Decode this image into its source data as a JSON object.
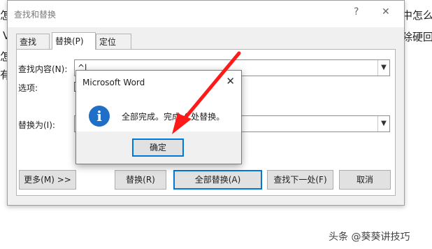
{
  "background_doc": {
    "left_fragments": [
      "怎么",
      "V",
      "怎么",
      "有器"
    ],
    "right_fragments": [
      "中怎么",
      "除硬回"
    ]
  },
  "find_replace": {
    "title": "查找和替换",
    "help_label": "?",
    "close_label": "✕",
    "tabs": [
      {
        "label": "查找(D)",
        "active": false
      },
      {
        "label": "替换(P)",
        "active": true
      },
      {
        "label": "定位(G)",
        "active": false
      }
    ],
    "find_label": "查找内容(N):",
    "find_value": "^l",
    "options_label": "选项:",
    "replace_label": "替换为(I):",
    "replace_value": "",
    "buttons": {
      "more": "更多(M) >>",
      "replace": "替换(R)",
      "replace_all": "全部替换(A)",
      "find_next": "查找下一处(F)",
      "cancel": "取消"
    }
  },
  "message_box": {
    "title": "Microsoft Word",
    "close_label": "✕",
    "message": "全部完成。完成 4 处替换。",
    "ok_label": "确定"
  },
  "annotation": {
    "arrow_color": "#ff1a1a"
  },
  "watermark": "头条 @葵葵讲技巧",
  "colors": {
    "accent": "#0078d7",
    "info_icon": "#1f6fc9"
  }
}
